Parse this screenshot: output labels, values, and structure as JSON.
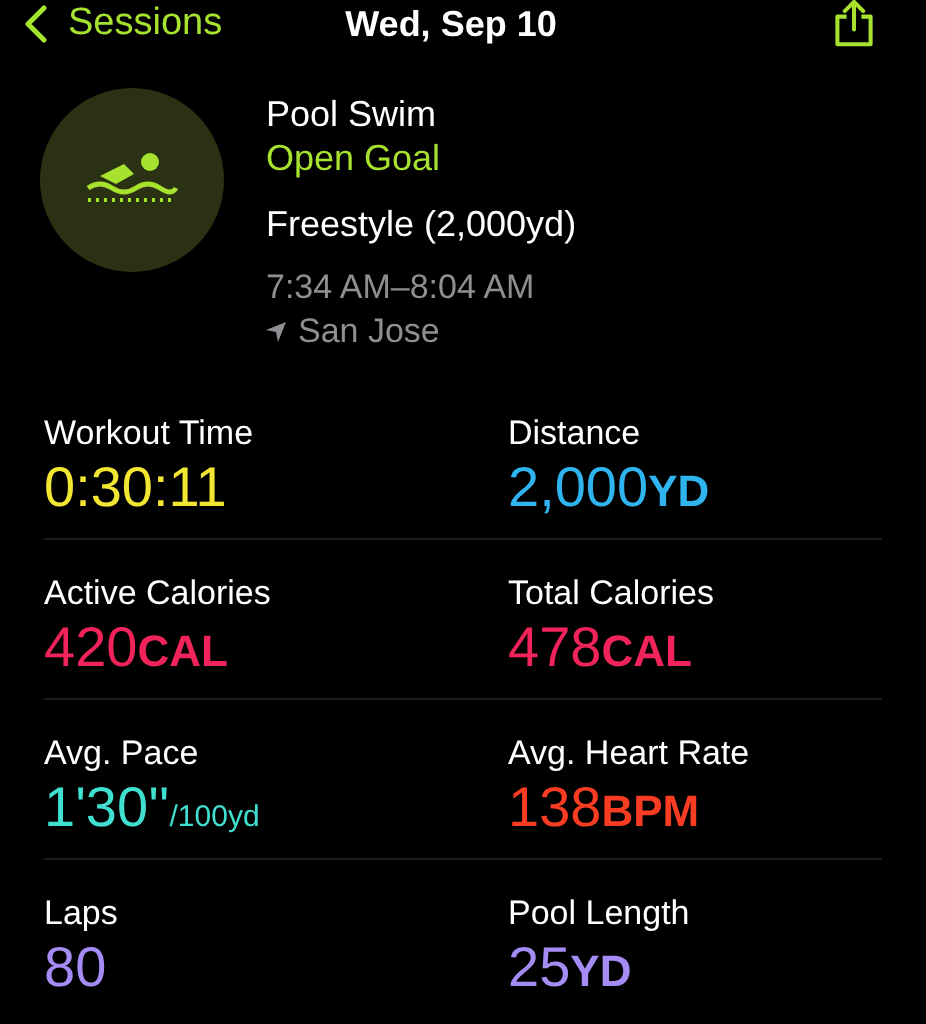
{
  "nav": {
    "back_label": "Sessions",
    "title": "Wed, Sep 10"
  },
  "summary": {
    "activity": "Pool Swim",
    "goal": "Open Goal",
    "stroke": "Freestyle (2,000yd)",
    "time_range": "7:34 AM–8:04 AM",
    "location": "San Jose"
  },
  "metrics": [
    {
      "label": "Workout Time",
      "value": "0:30:11",
      "color": "#f2e633"
    },
    {
      "label": "Distance",
      "value": "2,000",
      "unit": "YD",
      "color": "#2fb4f0"
    },
    {
      "label": "Active Calories",
      "value": "420",
      "unit": "CAL",
      "color": "#f0245a"
    },
    {
      "label": "Total Calories",
      "value": "478",
      "unit": "CAL",
      "color": "#f0245a"
    },
    {
      "label": "Avg. Pace",
      "value": "1'30''",
      "unit": "/100yd",
      "color": "#3fe0d0"
    },
    {
      "label": "Avg. Heart Rate",
      "value": "138",
      "unit": "BPM",
      "color": "#fa3c22"
    },
    {
      "label": "Laps",
      "value": "80",
      "color": "#a58cf5"
    },
    {
      "label": "Pool Length",
      "value": "25",
      "unit": "YD",
      "color": "#a58cf5"
    }
  ]
}
